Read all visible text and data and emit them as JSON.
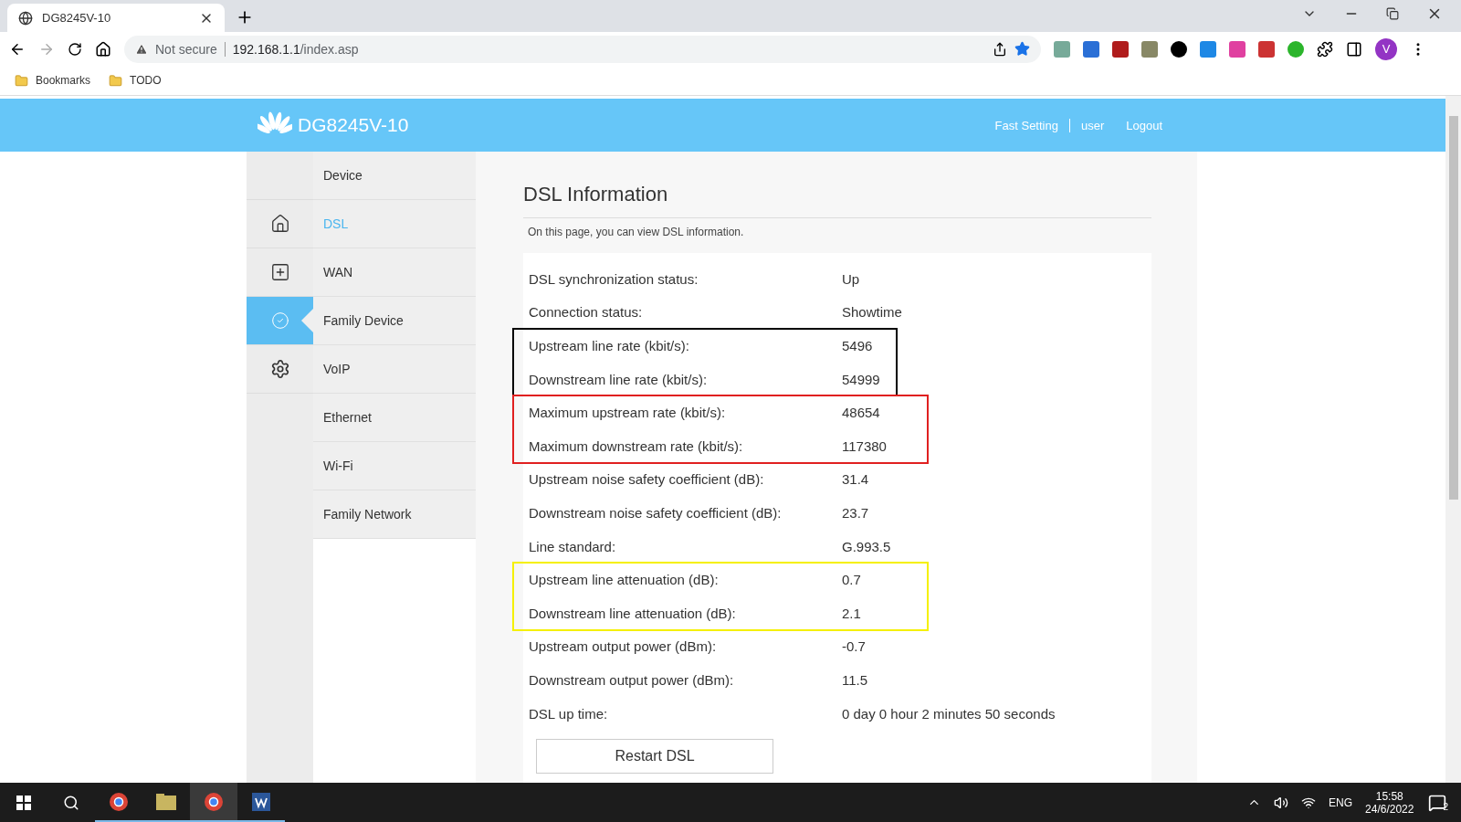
{
  "browser": {
    "tab_title": "DG8245V-10",
    "security": "Not secure",
    "url_host": "192.168.1.1",
    "url_path": "/index.asp",
    "bookmarks": [
      "Bookmarks",
      "TODO"
    ],
    "profile": "V"
  },
  "header": {
    "title": "DG8245V-10",
    "links": [
      "Fast Setting",
      "user",
      "Logout"
    ]
  },
  "categories": [
    {
      "kind": "blank",
      "selected": false
    },
    {
      "kind": "home",
      "selected": false
    },
    {
      "kind": "plus",
      "selected": false
    },
    {
      "kind": "monitor",
      "selected": true
    },
    {
      "kind": "gear",
      "selected": false
    }
  ],
  "menu": [
    {
      "label": "Device",
      "selected": false
    },
    {
      "label": "DSL",
      "selected": true
    },
    {
      "label": "WAN",
      "selected": false
    },
    {
      "label": "Family Device",
      "selected": false
    },
    {
      "label": "VoIP",
      "selected": false
    },
    {
      "label": "Ethernet",
      "selected": false
    },
    {
      "label": "Wi-Fi",
      "selected": false
    },
    {
      "label": "Family Network",
      "selected": false
    }
  ],
  "page": {
    "title": "DSL Information",
    "description": "On this page, you can view DSL information."
  },
  "groups": [
    {
      "rows": [
        {
          "label": "DSL synchronization status:",
          "value": "Up"
        },
        {
          "label": "Connection status:",
          "value": "Showtime"
        }
      ]
    },
    {
      "color": "#000000",
      "rows": [
        {
          "label": "Upstream line rate (kbit/s):",
          "value": "5496"
        },
        {
          "label": "Downstream line rate (kbit/s):",
          "value": "54999"
        }
      ]
    },
    {
      "color": "#e02020",
      "rows": [
        {
          "label": "Maximum upstream rate (kbit/s):",
          "value": "48654"
        },
        {
          "label": "Maximum downstream rate (kbit/s):",
          "value": "117380"
        }
      ]
    },
    {
      "rows": [
        {
          "label": "Upstream noise safety coefficient (dB):",
          "value": "31.4"
        },
        {
          "label": "Downstream noise safety coefficient (dB):",
          "value": "23.7"
        },
        {
          "label": "Line standard:",
          "value": "G.993.5"
        }
      ]
    },
    {
      "color": "#f5f000",
      "rows": [
        {
          "label": "Upstream line attenuation (dB):",
          "value": "0.7"
        },
        {
          "label": "Downstream line attenuation (dB):",
          "value": "2.1"
        }
      ]
    },
    {
      "rows": [
        {
          "label": "Upstream output power (dBm):",
          "value": "-0.7"
        },
        {
          "label": "Downstream output power (dBm):",
          "value": "11.5"
        },
        {
          "label": "DSL up time:",
          "value": "0 day 0 hour 2 minutes 50 seconds"
        }
      ]
    }
  ],
  "restart_button": "Restart DSL",
  "taskbar": {
    "language": "ENG",
    "time": "15:58",
    "date": "24/6/2022",
    "notifications": "2"
  }
}
